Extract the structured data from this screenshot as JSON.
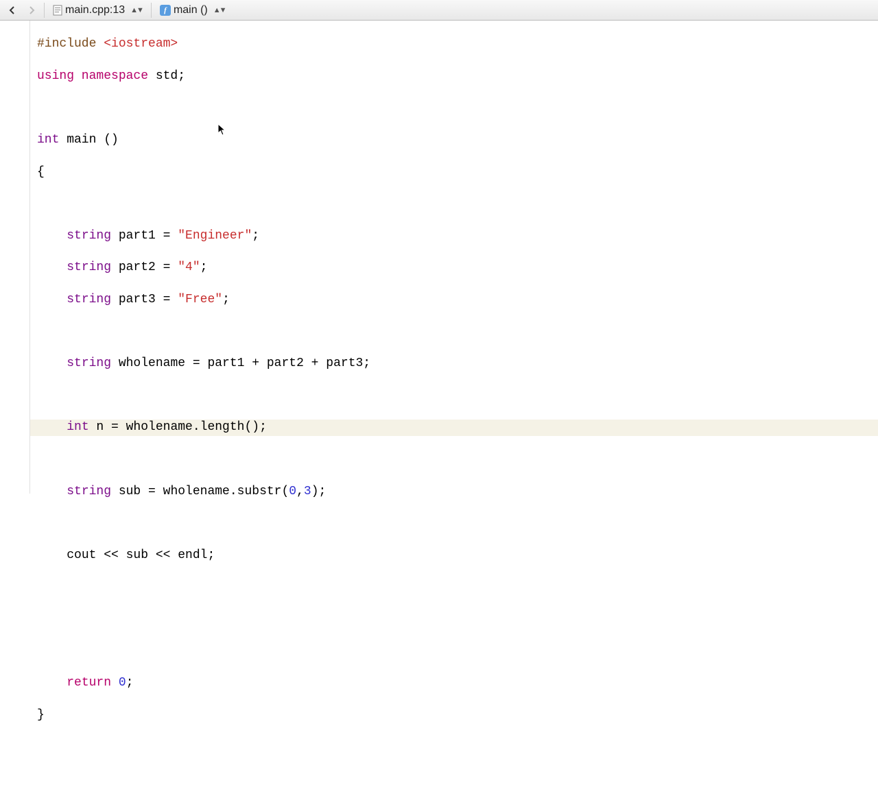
{
  "toolbar": {
    "file_label": "main.cpp:13",
    "func_label": "main ()"
  },
  "code": {
    "l1_pp": "#include ",
    "l1_inc": "<iostream>",
    "l2_kw": "using namespace",
    "l2_rest": " std;",
    "l4_type": "int",
    "l4_rest": " main ()",
    "l5": "{",
    "l7_type": "string",
    "l7_mid": " part1 = ",
    "l7_str": "\"Engineer\"",
    "l8_type": "string",
    "l8_mid": " part2 = ",
    "l8_str": "\"4\"",
    "l9_type": "string",
    "l9_mid": " part3 = ",
    "l9_str": "\"Free\"",
    "l11_type": "string",
    "l11_rest": " wholename = part1 + part2 + part3;",
    "l13_type": "int",
    "l13_rest": " n = wholename.length();",
    "l15_type": "string",
    "l15_mid": " sub = wholename.substr(",
    "l15_a": "0",
    "l15_c": ",",
    "l15_b": "3",
    "l15_end": ");",
    "l17_rest": "cout << sub << endl;",
    "l21_kw": "return",
    "l21_sp": " ",
    "l21_num": "0",
    "l21_end": ";",
    "l22": "}",
    "semi": ";"
  }
}
